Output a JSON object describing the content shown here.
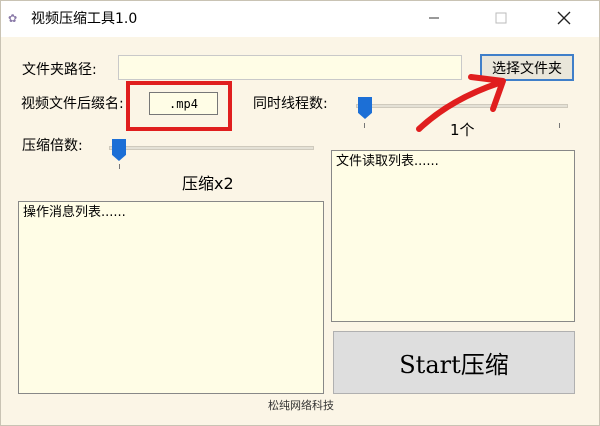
{
  "window": {
    "title": "视频压缩工具1.0",
    "icon": "app-icon",
    "controls": {
      "minimize_icon": "minimize-icon",
      "maximize_icon": "maximize-icon",
      "close_icon": "close-icon"
    }
  },
  "folder": {
    "label": "文件夹路径:",
    "value": "",
    "button_label": "选择文件夹"
  },
  "suffix": {
    "label": "视频文件后缀名:",
    "value": ".mp4"
  },
  "threads": {
    "label": "同时线程数:",
    "value_text": "1个",
    "slider_value": 0
  },
  "compression": {
    "label": "压缩倍数:",
    "value_text": "压缩x2",
    "slider_value": 0
  },
  "operations_list": {
    "text": "操作消息列表......"
  },
  "file_list": {
    "text": "文件读取列表......"
  },
  "start_button": {
    "label": "Start压缩"
  },
  "footer": {
    "text": "松纯网络科技"
  },
  "colors": {
    "window_bg": "#fbf5e6",
    "field_bg": "#fffde6",
    "accent": "#1c6fd6",
    "annotation_red": "#e01e1e"
  }
}
